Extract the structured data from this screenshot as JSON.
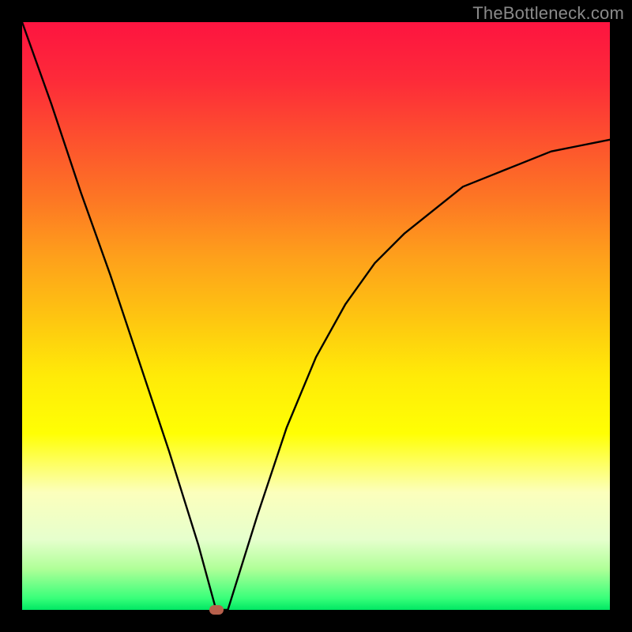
{
  "watermark": {
    "text": "TheBottleneck.com"
  },
  "colors": {
    "marker": "#b7604c",
    "curve": "#000000",
    "frame": "#000000"
  },
  "chart_data": {
    "type": "line",
    "title": "",
    "xlabel": "",
    "ylabel": "",
    "xlim": [
      0,
      100
    ],
    "ylim": [
      0,
      100
    ],
    "grid": false,
    "x": [
      0,
      5,
      10,
      15,
      20,
      25,
      30,
      33,
      35,
      40,
      45,
      50,
      55,
      60,
      65,
      70,
      75,
      80,
      85,
      90,
      95,
      100
    ],
    "values": [
      100,
      86,
      71,
      57,
      42,
      27,
      11,
      0,
      0,
      16,
      31,
      43,
      52,
      59,
      64,
      68,
      72,
      74,
      76,
      78,
      79,
      80
    ],
    "minimum_point": {
      "x": 33,
      "y": 0
    }
  }
}
